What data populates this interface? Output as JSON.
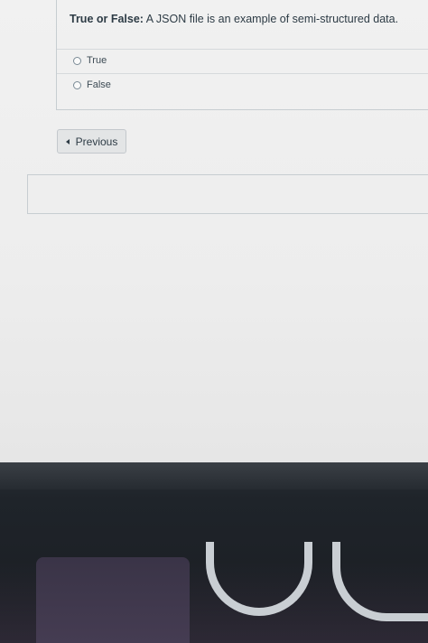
{
  "question": {
    "lead": "True or False:",
    "body": " A JSON file is an example of semi-structured data."
  },
  "answers": [
    {
      "label": "True",
      "selected": false
    },
    {
      "label": "False",
      "selected": false
    }
  ],
  "navigation": {
    "previous_label": "Previous",
    "previous_icon": "chevron-left-icon"
  },
  "colors": {
    "text": "#2d3b45",
    "border": "#c7cdd1",
    "button_bg": "#e3e5e6"
  }
}
